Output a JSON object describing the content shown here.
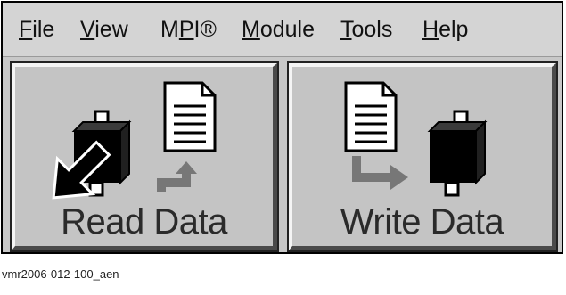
{
  "menu": {
    "items": [
      {
        "label": "File",
        "accel": "F",
        "rest": "ile"
      },
      {
        "label": "View",
        "accel": "V",
        "rest": "iew"
      },
      {
        "label": "MPI®",
        "pre": "M",
        "accel": "P",
        "post": "I®"
      },
      {
        "label": "Module",
        "accel": "M",
        "rest": "odule"
      },
      {
        "label": "Tools",
        "accel": "T",
        "rest": "ools"
      },
      {
        "label": "Help",
        "accel": "H",
        "rest": "elp"
      }
    ]
  },
  "buttons": {
    "read_label": "Read Data",
    "write_label": "Write Data"
  },
  "caption": "vmr2006-012-100_aen",
  "icons": {
    "read": [
      "module-chip-icon",
      "document-icon",
      "up-arrow-icon",
      "pointer-arrow-icon"
    ],
    "write": [
      "document-icon",
      "down-arrow-icon",
      "module-chip-icon"
    ]
  }
}
